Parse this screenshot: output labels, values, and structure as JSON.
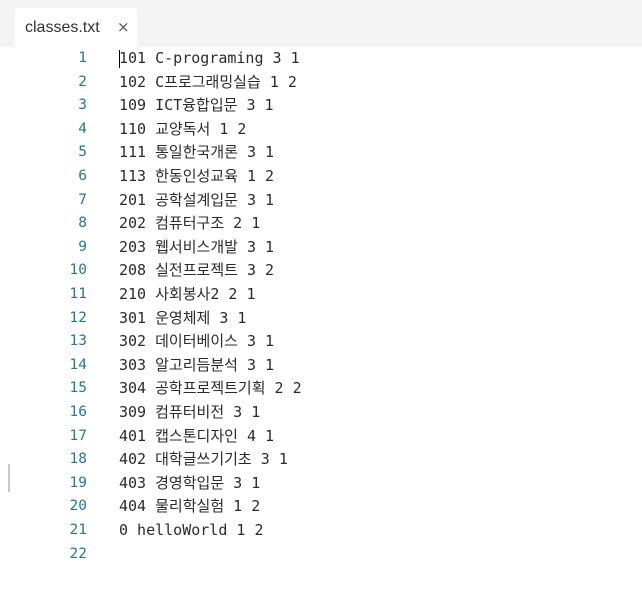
{
  "tab": {
    "title": "classes.txt",
    "close_glyph": "×"
  },
  "editor": {
    "lines": [
      {
        "n": "1",
        "text": "101 C-programing 3 1"
      },
      {
        "n": "2",
        "text": "102 C프로그래밍실습 1 2"
      },
      {
        "n": "3",
        "text": "109 ICT융합입문 3 1"
      },
      {
        "n": "4",
        "text": "110 교양독서 1 2"
      },
      {
        "n": "5",
        "text": "111 통일한국개론 3 1"
      },
      {
        "n": "6",
        "text": "113 한동인성교육 1 2"
      },
      {
        "n": "7",
        "text": "201 공학설계입문 3 1"
      },
      {
        "n": "8",
        "text": "202 컴퓨터구조 2 1"
      },
      {
        "n": "9",
        "text": "203 웹서비스개발 3 1"
      },
      {
        "n": "10",
        "text": "208 실전프로젝트 3 2"
      },
      {
        "n": "11",
        "text": "210 사회봉사2 2 1"
      },
      {
        "n": "12",
        "text": "301 운영체제 3 1"
      },
      {
        "n": "13",
        "text": "302 데이터베이스 3 1"
      },
      {
        "n": "14",
        "text": "303 알고리듬분석 3 1"
      },
      {
        "n": "15",
        "text": "304 공학프로젝트기획 2 2"
      },
      {
        "n": "16",
        "text": "309 컴퓨터비전 3 1"
      },
      {
        "n": "17",
        "text": "401 캡스톤디자인 4 1"
      },
      {
        "n": "18",
        "text": "402 대학글쓰기기초 3 1"
      },
      {
        "n": "19",
        "text": "403 경영학입문 3 1"
      },
      {
        "n": "20",
        "text": "404 물리학실험 1 2"
      },
      {
        "n": "21",
        "text": "0 helloWorld 1 2"
      },
      {
        "n": "22",
        "text": ""
      }
    ]
  }
}
